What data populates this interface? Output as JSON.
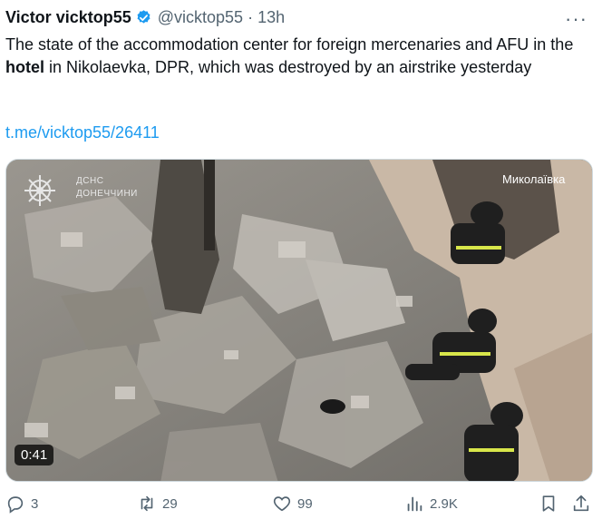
{
  "author": {
    "name": "Victor vicktop55",
    "handle": "@vicktop55",
    "separator": "·",
    "time": "13h"
  },
  "tweet": {
    "text_part1": "The state of the accommodation center for foreign mercenaries and AFU in the ",
    "text_bold": "hotel",
    "text_part2": " in Nikolaevka, DPR, which was destroyed by an airstrike yesterday",
    "link": "t.me/vicktop55/26411"
  },
  "media": {
    "duration": "0:41",
    "watermark_line1": "ДСНС",
    "watermark_line2": "ДОНЕЧЧИНИ",
    "location_label": "Миколаївка"
  },
  "actions": {
    "replies": "3",
    "reposts": "29",
    "likes": "99",
    "views": "2.9K"
  },
  "colors": {
    "accent": "#1d9bf0",
    "muted": "#536471",
    "verified": "#1d9bf0"
  }
}
